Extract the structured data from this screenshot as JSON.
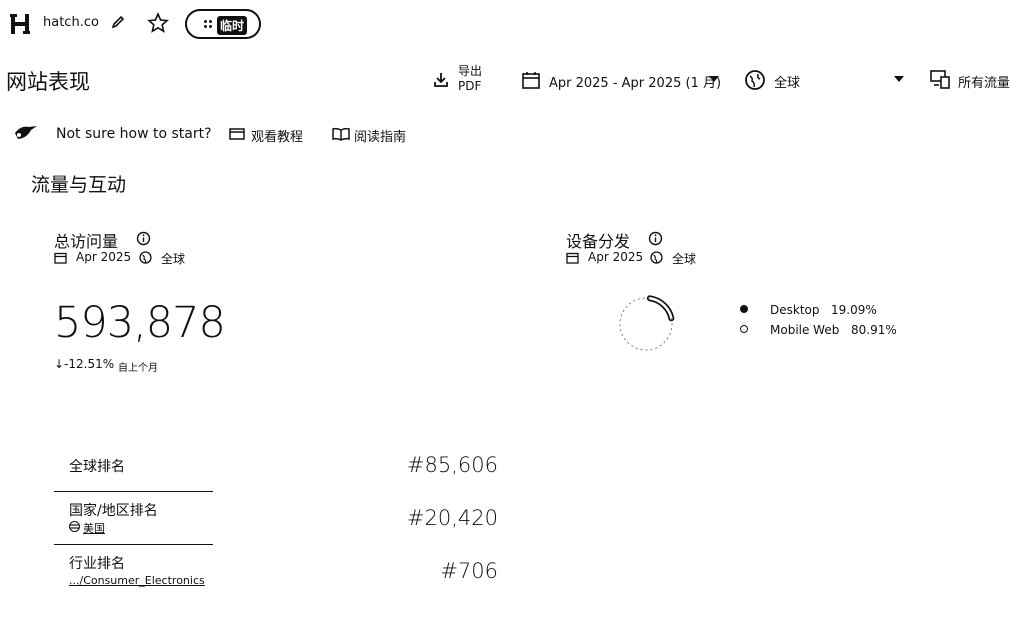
{
  "topbar": {
    "site": "hatch.co",
    "pill_label": "临时"
  },
  "header": {
    "title": "网站表现",
    "export_label": "导出 PDF",
    "date_range": "Apr 2025 - Apr 2025 (1 月)",
    "region": "全球",
    "traffic_type": "所有流量"
  },
  "help": {
    "question": "Not sure how to start?",
    "video_link": "观看教程",
    "guide_link": "阅读指南"
  },
  "section": {
    "title": "流量与互动"
  },
  "visits": {
    "title": "总访问量",
    "period": "Apr 2025",
    "region": "全球",
    "value": "593,878",
    "change": "↓-12.51%",
    "change_suffix": "自上个月"
  },
  "ranks": [
    {
      "label": "全球排名",
      "sub": "",
      "value": "#85,606"
    },
    {
      "label": "国家/地区排名",
      "sub": "美国",
      "value": "#20,420"
    },
    {
      "label": "行业排名",
      "sub": ".../Consumer_Electronics",
      "value": "#706"
    }
  ],
  "devices": {
    "title": "设备分发",
    "period": "Apr 2025",
    "region": "全球",
    "items": [
      {
        "name": "Desktop",
        "share": "19.09%"
      },
      {
        "name": "Mobile Web",
        "share": "80.91%"
      }
    ]
  },
  "chart_data": {
    "type": "pie",
    "categories": [
      "Desktop",
      "Mobile Web"
    ],
    "values": [
      19.09,
      80.91
    ],
    "title": "设备分发"
  }
}
